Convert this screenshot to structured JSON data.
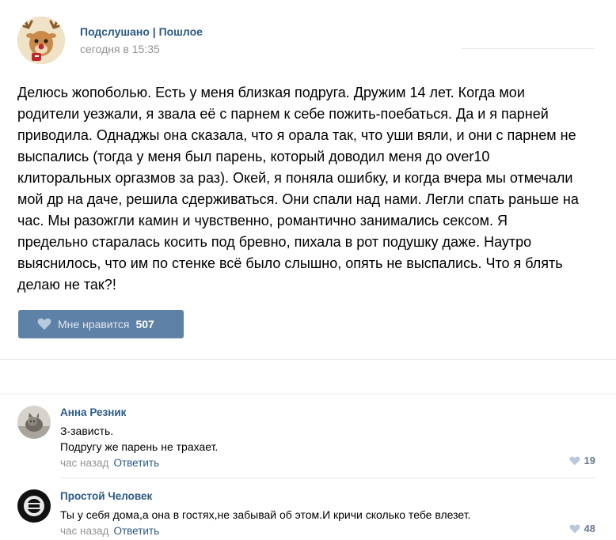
{
  "post": {
    "group_name": "Подслушано | Пошлое",
    "time": "сегодня в 15:35",
    "text_lines": [
      "Делюсь жопоболью. Есть у меня близкая подруга. Дружим 14 лет. Когда мои",
      "родители уезжали, я звала её с парнем к себе пожить-поебаться. Да и я парней",
      "приводила. Однаджы она сказала, что я орала так, что уши вяли, и они с парнем не",
      "выспались (тогда у меня был парень, который доводил меня до over10",
      "клиторальных оргазмов за раз). Окей, я поняла ошибку, и когда вчера мы отмечали",
      "мой др на даче, решила сдерживаться. Они спали над нами. Легли спать раньше на",
      "час. Мы разожгли камин и чувственно, романтично занимались сексом. Я",
      "предельно старалась косить под бревно, пихала в рот подушку даже. Наутро",
      "выяснилось, что им по стенке всё было слышно, опять не выспались. Что я блять",
      "делаю не так?!"
    ],
    "like_label": "Мне нравится",
    "like_count": "507",
    "accent_color": "#5e81a8",
    "link_color": "#2a5885"
  },
  "comments": [
    {
      "author": "Анна Резник",
      "lines": [
        "З-зависть.",
        "Подругу же парень не трахает."
      ],
      "time": "час назад",
      "reply": "Ответить",
      "likes": "19",
      "avatar_icon": "kitten-photo"
    },
    {
      "author": "Простой Человек",
      "lines": [
        "Ты у себя дома,а она в гостях,не забывай об этом.И кричи сколько тебе влезет."
      ],
      "time": "час назад",
      "reply": "Ответить",
      "likes": "48",
      "avatar_icon": "dark-graphic-avatar"
    }
  ]
}
